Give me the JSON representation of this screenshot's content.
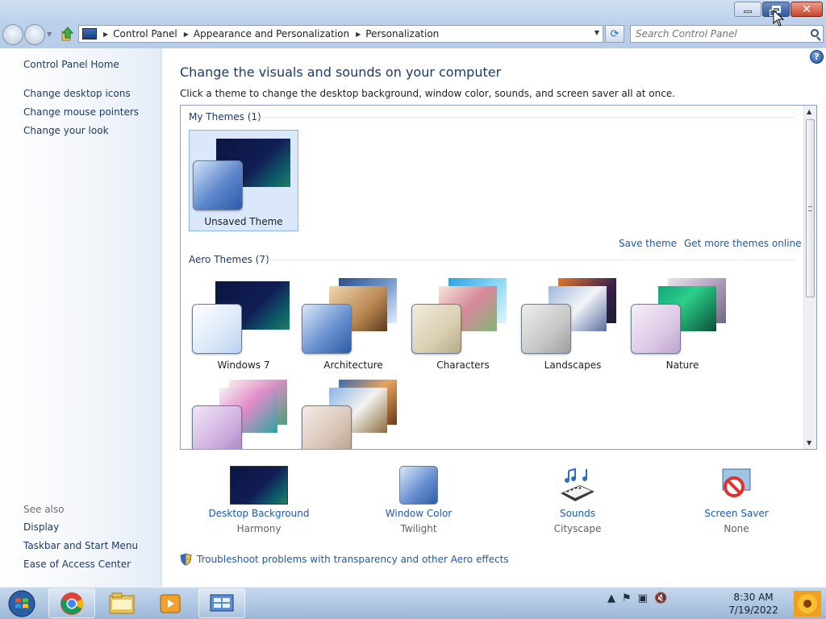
{
  "titlebar": {
    "buttons": [
      {
        "name": "minimize-button",
        "label": "–"
      },
      {
        "name": "maximize-button",
        "label": "restore"
      },
      {
        "name": "close-button",
        "label": "✕"
      }
    ]
  },
  "address": {
    "breadcrumbs": [
      "Control Panel",
      "Appearance and Personalization",
      "Personalization"
    ],
    "search_placeholder": "Search Control Panel"
  },
  "sidebar": {
    "home_label": "Control Panel Home",
    "links": [
      "Change desktop icons",
      "Change mouse pointers",
      "Change your look"
    ],
    "see_also_label": "See also",
    "see_also_links": [
      "Display",
      "Taskbar and Start Menu",
      "Ease of Access Center"
    ]
  },
  "main": {
    "title": "Change the visuals and sounds on your computer",
    "subtitle": "Click a theme to change the desktop background, window color, sounds, and screen saver all at once.",
    "my_themes_label": "My Themes (1)",
    "my_themes": [
      {
        "name": "Unsaved Theme"
      }
    ],
    "save_theme_label": "Save theme",
    "get_more_label": "Get more themes online",
    "aero_themes_label": "Aero Themes (7)",
    "aero_themes": [
      {
        "name": "Windows 7"
      },
      {
        "name": "Architecture"
      },
      {
        "name": "Characters"
      },
      {
        "name": "Landscapes"
      },
      {
        "name": "Nature"
      },
      {
        "name": ""
      },
      {
        "name": ""
      }
    ]
  },
  "settings": [
    {
      "link": "Desktop Background",
      "value": "Harmony",
      "icon": "desktop-background-icon"
    },
    {
      "link": "Window Color",
      "value": "Twilight",
      "icon": "window-color-icon"
    },
    {
      "link": "Sounds",
      "value": "Cityscape",
      "icon": "sounds-icon"
    },
    {
      "link": "Screen Saver",
      "value": "None",
      "icon": "screen-saver-icon"
    }
  ],
  "troubleshoot_label": "Troubleshoot problems with transparency and other Aero effects",
  "taskbar": {
    "items": [
      "chrome-icon",
      "file-explorer-icon",
      "media-player-icon",
      "control-panel-icon"
    ],
    "time": "8:30 AM",
    "date": "7/19/2022"
  },
  "colors": {
    "link": "#1e5aa8",
    "heading": "#1e3a64",
    "selected_tile": "#dbe8fb"
  }
}
